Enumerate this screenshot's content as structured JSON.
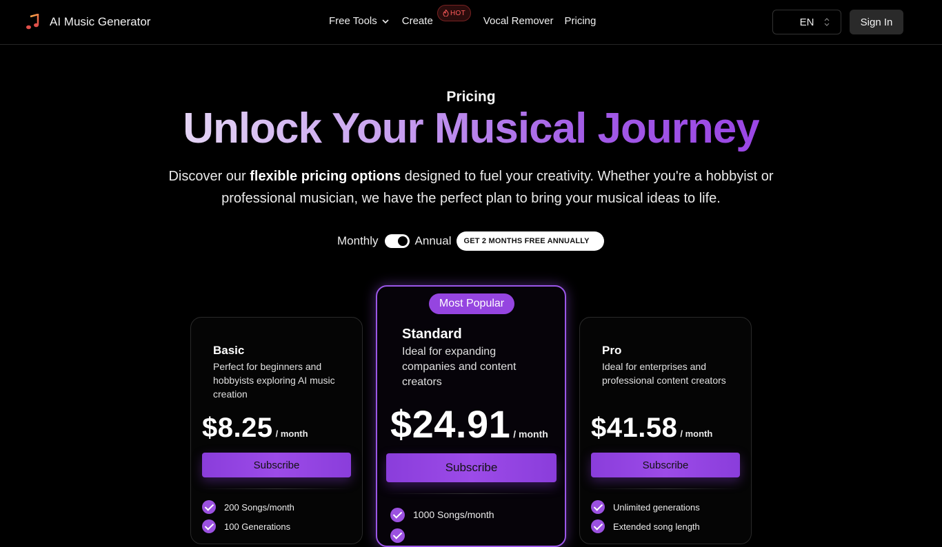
{
  "header": {
    "brand": "AI Music Generator",
    "nav": {
      "free_tools": "Free Tools",
      "create": "Create",
      "hot_badge": "HOT",
      "vocal_remover": "Vocal Remover",
      "pricing": "Pricing"
    },
    "language": "EN",
    "sign_in": "Sign In"
  },
  "hero": {
    "eyebrow": "Pricing",
    "headline": "Unlock Your Musical Journey",
    "subtitle_prefix": "Discover our ",
    "subtitle_bold": "flexible pricing options",
    "subtitle_suffix": " designed to fuel your creativity. Whether you're a hobbyist or professional musician, we have the perfect plan to bring your musical ideas to life."
  },
  "billing": {
    "monthly": "Monthly",
    "annual": "Annual",
    "annual_selected": true,
    "promo": "GET 2 MONTHS FREE ANNUALLY"
  },
  "plans": {
    "basic": {
      "name": "Basic",
      "description": "Perfect for beginners and hobbyists exploring AI music creation",
      "price": "$8.25",
      "period": "/ month",
      "cta": "Subscribe",
      "features": [
        "200 Songs/month",
        "100 Generations"
      ]
    },
    "standard": {
      "badge": "Most Popular",
      "name": "Standard",
      "description": "Ideal for expanding companies and content creators",
      "price": "$24.91",
      "period": "/ month",
      "cta": "Subscribe",
      "features": [
        "1000 Songs/month"
      ]
    },
    "pro": {
      "name": "Pro",
      "description": "Ideal for enterprises and professional content creators",
      "price": "$41.58",
      "period": "/ month",
      "cta": "Subscribe",
      "features": [
        "Unlimited generations",
        "Extended song length"
      ]
    }
  },
  "colors": {
    "accent": "#9b51e0",
    "hot": "#ff5b5b",
    "background": "#000000"
  }
}
